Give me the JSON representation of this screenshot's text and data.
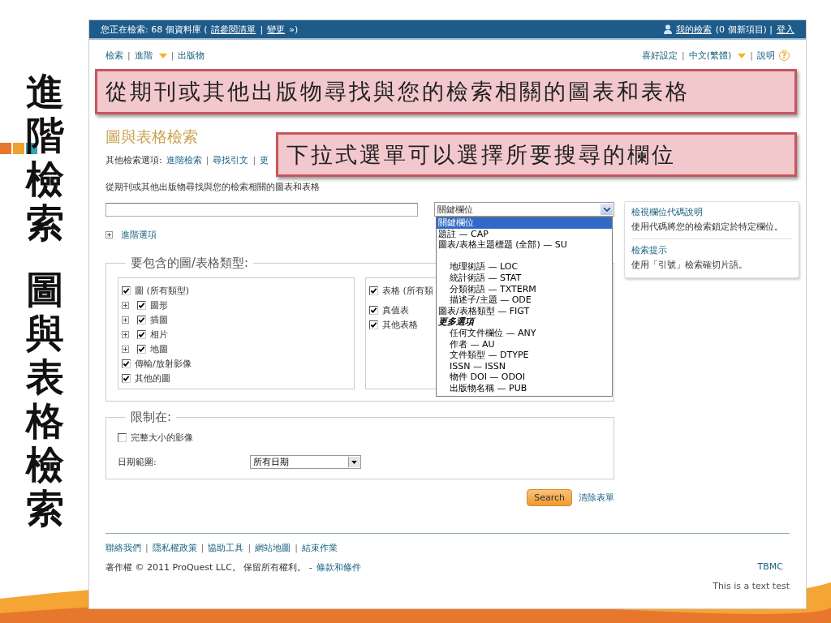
{
  "slide": {
    "title_columns": [
      "進階檢索",
      "圖與表格檢索"
    ]
  },
  "callouts": [
    "從期刊或其他出版物尋找與您的檢索相關的圖表和表格",
    "下拉式選單可以選擇所要搜尋的欄位"
  ],
  "top_bar": {
    "status": "您正在檢索: 68 個資料庫 (",
    "list_link": "請參閱清單",
    "separator": "|",
    "change_link": "變更",
    "close": "»)",
    "my_search_link": "我的檢索",
    "new_items": "(0 個新項目) |",
    "login_link": "登入"
  },
  "nav": {
    "separator": "|",
    "left": [
      {
        "label": "檢索",
        "menu": false
      },
      {
        "label": "進階",
        "menu": true
      },
      {
        "label": "出版物",
        "menu": false
      }
    ],
    "right": [
      {
        "label": "喜好設定",
        "menu": false
      },
      {
        "label": "中文(繁體)",
        "menu": true
      },
      {
        "label": "說明",
        "menu": false
      }
    ],
    "help_icon": "?"
  },
  "page_title": "圖與表格檢索",
  "other_options": {
    "label": "其他檢索選項:",
    "separator": "|",
    "links": [
      "進階檢索",
      "尋找引文",
      "更"
    ]
  },
  "description": "從期刊或其他出版物尋找與您的檢索相關的圖表和表格",
  "search": {
    "field_select": {
      "value": "關鍵欄位",
      "open": true,
      "options": [
        {
          "kind": "option",
          "label": "關鍵欄位",
          "selected": true
        },
        {
          "kind": "option",
          "label": "題註 — CAP",
          "selected": false
        },
        {
          "kind": "option",
          "label": "圖表/表格主題標題 (全部) — SU",
          "selected": false,
          "children": [
            {
              "kind": "option",
              "label": "地理術語 — LOC",
              "selected": false
            },
            {
              "kind": "option",
              "label": "統計術語 — STAT",
              "selected": false
            },
            {
              "kind": "option",
              "label": "分類術語 — TXTERM",
              "selected": false
            },
            {
              "kind": "option",
              "label": "描述子/主題 — ODE",
              "selected": false
            }
          ]
        },
        {
          "kind": "option",
          "label": "圖表/表格類型 — FIGT",
          "selected": false
        },
        {
          "kind": "group",
          "label": "更多選項",
          "children": [
            {
              "kind": "option",
              "label": "任何文件欄位 — ANY",
              "selected": false
            },
            {
              "kind": "option",
              "label": "作者 — AU",
              "selected": false
            },
            {
              "kind": "option",
              "label": "文件類型 — DTYPE",
              "selected": false
            },
            {
              "kind": "option",
              "label": "ISSN — ISSN",
              "selected": false
            },
            {
              "kind": "option",
              "label": "物件 DOI — ODOI",
              "selected": false
            },
            {
              "kind": "option",
              "label": "出版物名稱 — PUB",
              "selected": false
            }
          ]
        }
      ]
    }
  },
  "advanced_options": {
    "label": "進階選項",
    "expanded": false
  },
  "types_fieldset": {
    "legend": "要包含的圖/表格類型:",
    "figures": [
      {
        "label": "圖 (所有類型)",
        "checked": true,
        "children": [
          {
            "label": "圖形",
            "checked": true,
            "expanded": false
          },
          {
            "label": "插圖",
            "checked": true,
            "expanded": false
          },
          {
            "label": "相片",
            "checked": true,
            "expanded": false
          },
          {
            "label": "地圖",
            "checked": true,
            "expanded": false
          }
        ]
      },
      {
        "label": "傳輸/放射影像",
        "checked": true
      },
      {
        "label": "其他的圖",
        "checked": true
      }
    ],
    "tables": [
      {
        "label": "表格 (所有類",
        "checked": true
      },
      {
        "label": "真值表",
        "checked": true
      },
      {
        "label": "其他表格",
        "checked": true
      }
    ]
  },
  "limit_fieldset": {
    "legend": "限制在:",
    "full_size": {
      "label": "完整大小的影像",
      "checked": false
    },
    "date_label": "日期範圍:",
    "date_value": "所有日期"
  },
  "actions": {
    "search": "Search",
    "clear": "清除表單"
  },
  "sidebar": [
    {
      "title": "檢視欄位代碼說明",
      "text": "使用代碼將您的檢索鎖定於特定欄位。"
    },
    {
      "title": "檢索提示",
      "text": "使用「引號」檢索確切片語。"
    }
  ],
  "footer": {
    "separator": "|",
    "links": [
      "聯絡我們",
      "隱私權政策",
      "協助工具",
      "網站地圖",
      "結束作業"
    ],
    "copyright": "著作權 © 2011 ProQuest LLC。 保留所有權利。 -",
    "terms_link": "條款和條件",
    "org_link": "TBMC",
    "note": "This is a text test"
  }
}
